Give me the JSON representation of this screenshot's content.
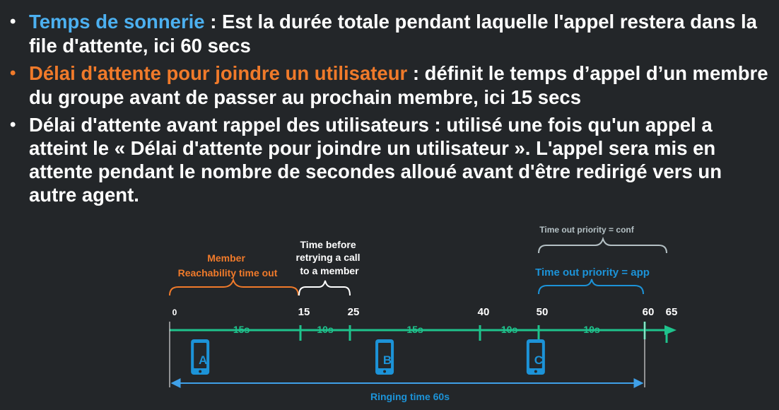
{
  "bullets": [
    {
      "term": "Temps de sonnerie",
      "text": " : Est la durée totale pendant laquelle l'appel restera dans la file d'attente, ici 60 secs",
      "term_color": "#4cb0f0"
    },
    {
      "term": "Délai d'attente pour joindre un utilisateur",
      "text": " : définit le temps d’appel d’un membre du groupe avant de passer au prochain membre, ici 15 secs",
      "term_color": "#f07a2a"
    },
    {
      "term": "",
      "text": "Délai d'attente avant rappel des utilisateurs : utilisé une fois qu'un appel a atteint le « Délai d'attente pour joindre un utilisateur ». L'appel sera mis en attente pendant le nombre de secondes alloué avant d'être redirigé vers un autre agent."
    }
  ],
  "diagram": {
    "member_reachability_label": [
      "Member",
      "Reachability time out"
    ],
    "retry_label": [
      "Time before",
      "retrying a call",
      "to a member"
    ],
    "priority_conf_label": "Time out priority = conf",
    "priority_app_label": "Time out priority = app",
    "ticks": [
      {
        "value": 0,
        "label": "0"
      },
      {
        "value": 15,
        "label": "15"
      },
      {
        "value": 25,
        "label": "25"
      },
      {
        "value": 40,
        "label": "40"
      },
      {
        "value": 50,
        "label": "50"
      },
      {
        "value": 60,
        "label": "60"
      },
      {
        "value": 65,
        "label": "65"
      }
    ],
    "segments": [
      {
        "label": "15s",
        "from": 0,
        "to": 15
      },
      {
        "label": "10s",
        "from": 15,
        "to": 25
      },
      {
        "label": "15s",
        "from": 25,
        "to": 40
      },
      {
        "label": "10s",
        "from": 40,
        "to": 50
      },
      {
        "label": "10s",
        "from": 50,
        "to": 60
      }
    ],
    "phones": [
      {
        "letter": "A",
        "at": 3.5
      },
      {
        "letter": "B",
        "at": 29
      },
      {
        "letter": "C",
        "at": 49.5
      }
    ],
    "ringing_label": "Ringing time 60s",
    "colors": {
      "timeline": "#1fc28c",
      "orange": "#f07a2a",
      "blue": "#1c93d8",
      "white": "#ffffff",
      "gray": "#b4c0c4"
    }
  }
}
